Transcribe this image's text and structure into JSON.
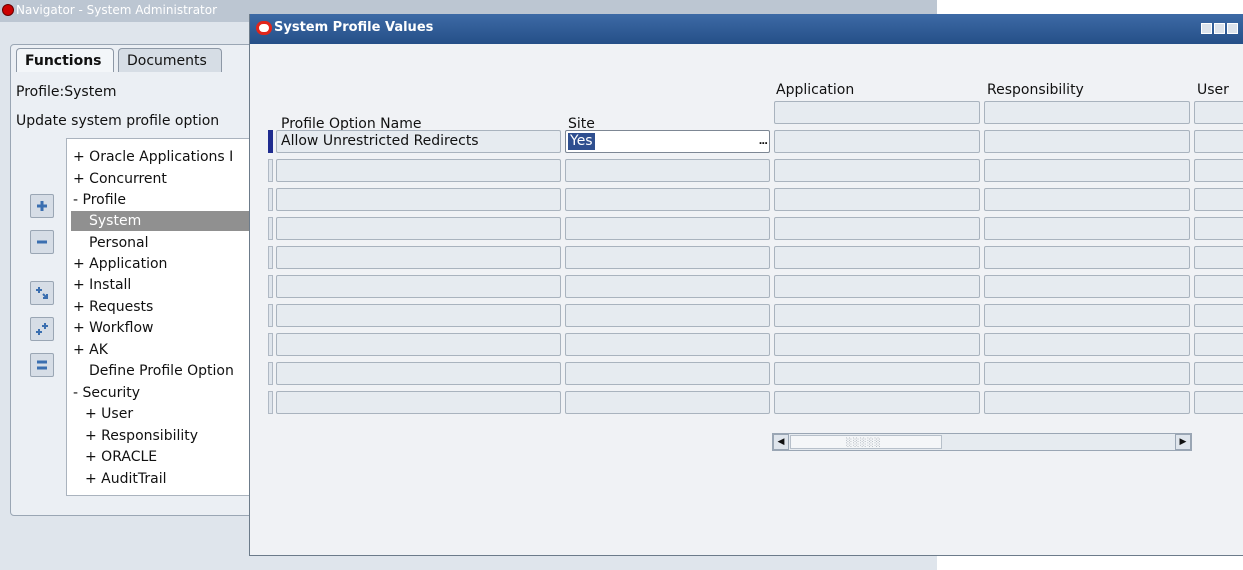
{
  "navigator": {
    "title": "Navigator - System Administrator",
    "tabs": [
      "Functions",
      "Documents"
    ],
    "profile_label": "Profile:System",
    "update_label": "Update system profile option",
    "tree": [
      {
        "label": "+ Oracle Applications I",
        "selected": false
      },
      {
        "label": "+ Concurrent",
        "selected": false
      },
      {
        "label": "- Profile",
        "selected": false
      },
      {
        "label": "System",
        "selected": true
      },
      {
        "label": "Personal",
        "selected": false
      },
      {
        "label": "+ Application",
        "selected": false
      },
      {
        "label": "+ Install",
        "selected": false
      },
      {
        "label": "+ Requests",
        "selected": false
      },
      {
        "label": "+ Workflow",
        "selected": false
      },
      {
        "label": "+ AK",
        "selected": false
      },
      {
        "label": "Define Profile Option",
        "selected": false
      },
      {
        "label": "- Security",
        "selected": false
      },
      {
        "label": "+ User",
        "selected": false
      },
      {
        "label": "+ Responsibility",
        "selected": false
      },
      {
        "label": "+ ORACLE",
        "selected": false
      },
      {
        "label": "+ AuditTrail",
        "selected": false
      }
    ],
    "tree_buttons": [
      "expand-icon",
      "collapse-icon",
      "expand-branch-icon",
      "expand-all-icon",
      "collapse-all-icon"
    ]
  },
  "dialog": {
    "title": "System Profile Values",
    "columns": {
      "profile_option_name": "Profile Option Name",
      "site": "Site",
      "application": "Application",
      "responsibility": "Responsibility",
      "user": "User"
    },
    "rows": [
      {
        "profile_option_name": "Allow Unrestricted Redirects",
        "site": "Yes",
        "application": "",
        "responsibility": "",
        "user": ""
      }
    ],
    "empty_row_count": 9,
    "lov_button": "..."
  },
  "colors": {
    "dialog_titlebar": "#2f5b96",
    "oracle_red": "#e1251b",
    "selection": "#2f4f8f",
    "tree_selection": "#909090"
  }
}
